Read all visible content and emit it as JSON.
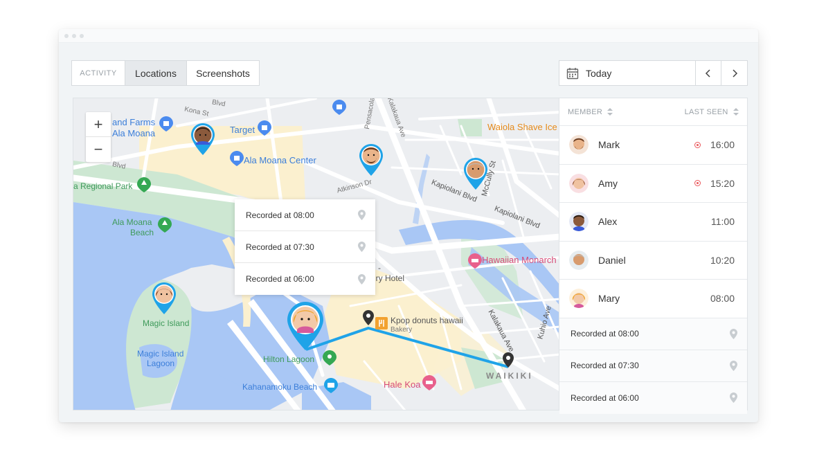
{
  "tabs": {
    "activity": "ACTIVITY",
    "locations": "Locations",
    "screenshots": "Screenshots"
  },
  "date": {
    "label": "Today"
  },
  "map": {
    "zoom_in": "+",
    "zoom_out": "−",
    "labels": {
      "kona_st": "Kona St",
      "blvd_top": "Blvd",
      "and_farms": "and Farms",
      "ala_moana_left": "Ala Moana",
      "target": "Target",
      "ala_moana_center": "Ala Moana Center",
      "pohukaina": "Pensacola St",
      "kalakaua_ave_top": "Kalakaua Ave",
      "waiola": "Waiola Shave Ice",
      "regional_park": "a Regional Park",
      "blvd_left": "Blvd",
      "ala_moana_beach_1": "Ala Moana",
      "ala_moana_beach_2": "Beach",
      "atkinson": "Atkinson Dr",
      "kapiolani_1": "Kapiolani Blvd",
      "kapiolani_2": "Kapiolani Blvd",
      "mccully": "McCully St",
      "hawaiian_monarch": "Hawaiian Monarch",
      "luxury_1": "i -",
      "luxury_2": "ury Hotel",
      "magic_island": "Magic Island",
      "magic_lagoon_1": "Magic Island",
      "magic_lagoon_2": "Lagoon",
      "kpop_1": "Kpop donuts hawaii",
      "kpop_2": "Bakery",
      "hilton_lagoon": "Hilton Lagoon",
      "kahanamoku": "Kahanamoku Beach",
      "hale_koa": "Hale Koa",
      "waikiki": "WAIKIKI",
      "kalakaua_ave_bottom": "Kalakaua Ave",
      "kuhio": "Kuhio Ave"
    },
    "popup": [
      {
        "text": "Recorded at 08:00"
      },
      {
        "text": "Recorded at 07:30"
      },
      {
        "text": "Recorded at 06:00"
      }
    ]
  },
  "panel": {
    "col_member": "MEMBER",
    "col_last_seen": "LAST SEEN",
    "members": [
      {
        "name": "Mark",
        "time": "16:00",
        "online": true
      },
      {
        "name": "Amy",
        "time": "15:20",
        "online": true
      },
      {
        "name": "Alex",
        "time": "11:00",
        "online": false
      },
      {
        "name": "Daniel",
        "time": "10:20",
        "online": false
      },
      {
        "name": "Mary",
        "time": "08:00",
        "online": false
      }
    ],
    "records": [
      {
        "text": "Recorded at 08:00"
      },
      {
        "text": "Recorded at 07:30"
      },
      {
        "text": "Recorded at 06:00"
      }
    ]
  },
  "colors": {
    "route": "#1fa3e8",
    "water": "#a9c7f5",
    "park": "#cde7d2",
    "sand": "#fbf0cf",
    "accent_red": "#e9565a"
  },
  "icons": [
    "calendar-icon",
    "chevron-left-icon",
    "chevron-right-icon",
    "location-pin-icon",
    "sort-icon",
    "shopping-bag-icon",
    "park-icon",
    "restaurant-icon",
    "hotel-icon",
    "camera-icon"
  ]
}
